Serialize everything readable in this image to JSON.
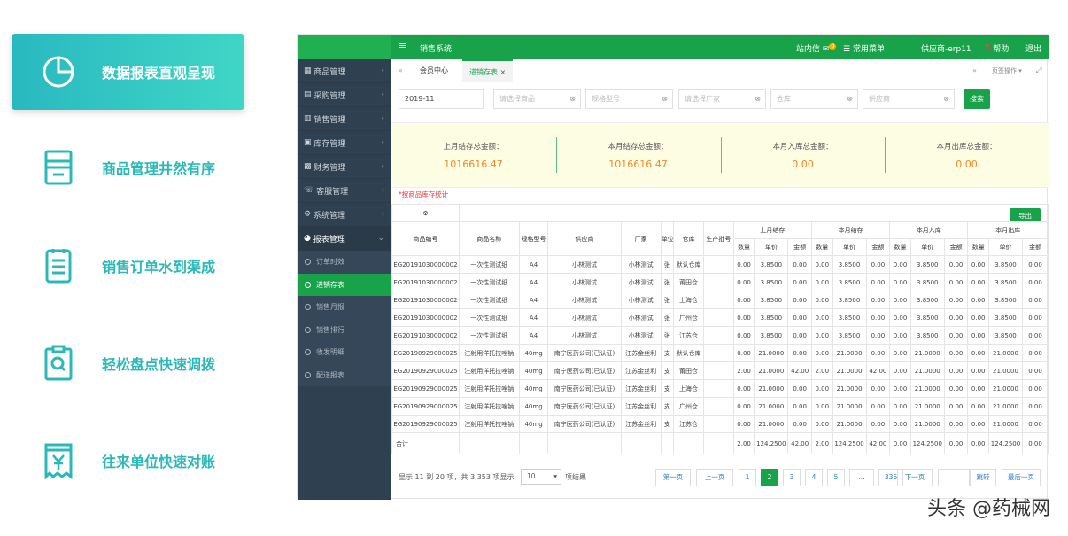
{
  "promo": [
    {
      "label": "数据报表直观呈现",
      "icon": "pie-chart-icon"
    },
    {
      "label": "商品管理井然有序",
      "icon": "inventory-box-icon"
    },
    {
      "label": "销售订单水到渠成",
      "icon": "order-list-icon"
    },
    {
      "label": "轻松盘点快速调拨",
      "icon": "clipboard-search-icon"
    },
    {
      "label": "往来单位快速对账",
      "icon": "yuan-receipt-icon"
    }
  ],
  "topbar": {
    "menu_icon": "≡",
    "system": "销售系统",
    "inbox": "站内信",
    "inbox_count": "0",
    "common_menu": "常用菜单",
    "user": "供应商-erp11",
    "help": "帮助",
    "logout": "退出"
  },
  "sidebar": {
    "items": [
      "商品管理",
      "采购管理",
      "销售管理",
      "库存管理",
      "财务管理",
      "客服管理",
      "系统管理",
      "报表管理"
    ],
    "subitems": [
      "订单时效",
      "进销存表",
      "销售月报",
      "销售排行",
      "收发明细",
      "配送报表"
    ]
  },
  "tabs": {
    "back": "«",
    "home": "会员中心",
    "active": "进销存表",
    "close": "×",
    "forward": "»",
    "page_ops": "页签操作 ▾",
    "expand": "⤢"
  },
  "filters": {
    "month": "2019-11",
    "product": "请选择商品",
    "spec": "规格型号",
    "maker": "请选择厂家",
    "warehouse": "仓库",
    "supplier": "供应商",
    "search": "搜索",
    "clear": "⊗"
  },
  "summary": [
    {
      "label": "上月结存总金额：",
      "value": "1016616.47"
    },
    {
      "label": "本月结存总金额：",
      "value": "1016616.47"
    },
    {
      "label": "本月入库总金额：",
      "value": "0.00"
    },
    {
      "label": "本月出库总金额：",
      "value": "0.00"
    }
  ],
  "note": "*按商品库存统计",
  "table": {
    "gear": "⚙",
    "export": "导出",
    "cols": [
      "商品编号",
      "商品名称",
      "规格型号",
      "供应商",
      "厂家",
      "单位",
      "仓库",
      "生产批号"
    ],
    "groups": [
      "上月结存",
      "本月结存",
      "本月入库",
      "本月出库"
    ],
    "sub": [
      "数量",
      "单价",
      "金额"
    ],
    "rows": [
      [
        "EG20191030000002",
        "一次性测试纸",
        "A4",
        "小林测试",
        "小林测试",
        "张",
        "默认仓库",
        "",
        "0.00",
        "3.8500",
        "0.00",
        "0.00",
        "3.8500",
        "0.00",
        "0.00",
        "3.8500",
        "0.00",
        "0.00",
        "3.8500",
        "0.00"
      ],
      [
        "EG20191030000002",
        "一次性测试纸",
        "A4",
        "小林测试",
        "小林测试",
        "张",
        "莆田仓",
        "",
        "0.00",
        "3.8500",
        "0.00",
        "0.00",
        "3.8500",
        "0.00",
        "0.00",
        "3.8500",
        "0.00",
        "0.00",
        "3.8500",
        "0.00"
      ],
      [
        "EG20191030000002",
        "一次性测试纸",
        "A4",
        "小林测试",
        "小林测试",
        "张",
        "上海仓",
        "",
        "0.00",
        "3.8500",
        "0.00",
        "0.00",
        "3.8500",
        "0.00",
        "0.00",
        "3.8500",
        "0.00",
        "0.00",
        "3.8500",
        "0.00"
      ],
      [
        "EG20191030000002",
        "一次性测试纸",
        "A4",
        "小林测试",
        "小林测试",
        "张",
        "广州仓",
        "",
        "0.00",
        "3.8500",
        "0.00",
        "0.00",
        "3.8500",
        "0.00",
        "0.00",
        "3.8500",
        "0.00",
        "0.00",
        "3.8500",
        "0.00"
      ],
      [
        "EG20191030000002",
        "一次性测试纸",
        "A4",
        "小林测试",
        "小林测试",
        "张",
        "江苏仓",
        "",
        "0.00",
        "3.8500",
        "0.00",
        "0.00",
        "3.8500",
        "0.00",
        "0.00",
        "3.8500",
        "0.00",
        "0.00",
        "3.8500",
        "0.00"
      ],
      [
        "EG20190929000025",
        "注射用洋托拉唑钠",
        "40mg",
        "南宁医药公司(已认证)",
        "江苏金丝利",
        "支",
        "默认仓库",
        "",
        "0.00",
        "21.0000",
        "0.00",
        "0.00",
        "21.0000",
        "0.00",
        "0.00",
        "21.0000",
        "0.00",
        "0.00",
        "21.0000",
        "0.00"
      ],
      [
        "EG20190929000025",
        "注射用洋托拉唑钠",
        "40mg",
        "南宁医药公司(已认证)",
        "江苏金丝利",
        "支",
        "莆田仓",
        "",
        "2.00",
        "21.0000",
        "42.00",
        "2.00",
        "21.0000",
        "42.00",
        "0.00",
        "21.0000",
        "0.00",
        "0.00",
        "21.0000",
        "0.00"
      ],
      [
        "EG20190929000025",
        "注射用洋托拉唑钠",
        "40mg",
        "南宁医药公司(已认证)",
        "江苏金丝利",
        "支",
        "上海仓",
        "",
        "0.00",
        "21.0000",
        "0.00",
        "0.00",
        "21.0000",
        "0.00",
        "0.00",
        "21.0000",
        "0.00",
        "0.00",
        "21.0000",
        "0.00"
      ],
      [
        "EG20190929000025",
        "注射用洋托拉唑钠",
        "40mg",
        "南宁医药公司(已认证)",
        "江苏金丝利",
        "支",
        "广州仓",
        "",
        "0.00",
        "21.0000",
        "0.00",
        "0.00",
        "21.0000",
        "0.00",
        "0.00",
        "21.0000",
        "0.00",
        "0.00",
        "21.0000",
        "0.00"
      ],
      [
        "EG20190929000025",
        "注射用洋托拉唑钠",
        "40mg",
        "南宁医药公司(已认证)",
        "江苏金丝利",
        "支",
        "江苏仓",
        "",
        "0.00",
        "21.0000",
        "0.00",
        "0.00",
        "21.0000",
        "0.00",
        "0.00",
        "21.0000",
        "0.00",
        "0.00",
        "21.0000",
        "0.00"
      ]
    ],
    "total": [
      "合计",
      "",
      "",
      "",
      "",
      "",
      "",
      "",
      "2.00",
      "124.2500",
      "42.00",
      "2.00",
      "124.2500",
      "42.00",
      "0.00",
      "124.2500",
      "0.00",
      "0.00",
      "124.2500",
      "0.00"
    ]
  },
  "pager": {
    "info": "显示 11 到 20 项，共 3,353 项显示",
    "page_size": "10",
    "info2": "项结果",
    "first": "第一页",
    "prev": "上一页",
    "pages": [
      "1",
      "2",
      "3",
      "4",
      "5",
      "...",
      "336"
    ],
    "next": "下一页",
    "jump": "跳转",
    "last": "最后一页"
  },
  "watermark": "头条 @药械网"
}
